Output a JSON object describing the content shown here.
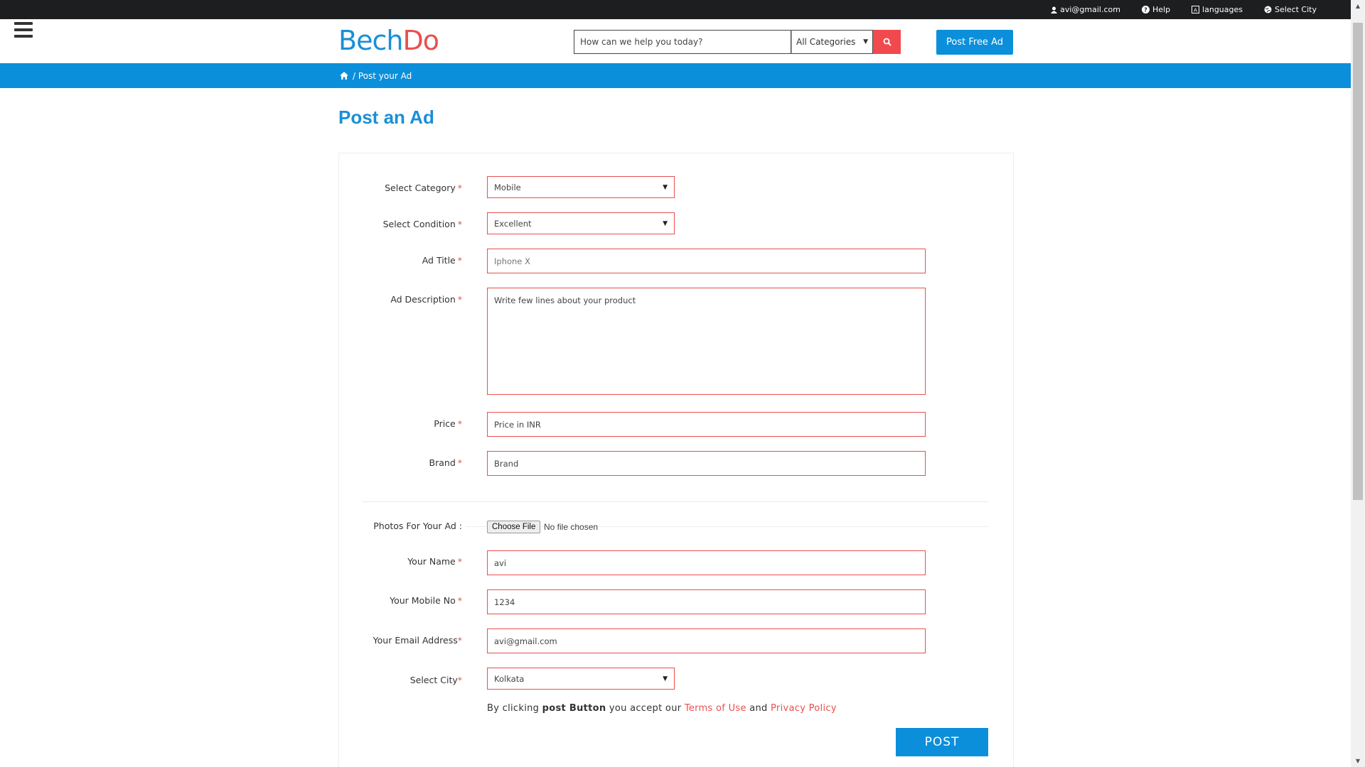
{
  "topbar": {
    "email": "avi@gmail.com",
    "help": "Help",
    "languages": "languages",
    "city": "Select City"
  },
  "header": {
    "logo_part1": "Bech",
    "logo_part2": "Do",
    "search_placeholder": "How can we help you today?",
    "category_select": "All Categories",
    "post_free_ad": "Post Free Ad"
  },
  "breadcrumb": {
    "home_icon": "home-icon",
    "current": "/ Post your Ad"
  },
  "page_title": "Post an Ad",
  "form": {
    "category": {
      "label": "Select Category",
      "value": "Mobile"
    },
    "condition": {
      "label": "Select Condition",
      "value": "Excellent"
    },
    "ad_title": {
      "label": "Ad Title",
      "placeholder": "Iphone X"
    },
    "ad_description": {
      "label": "Ad Description",
      "placeholder": "Write few lines about your product"
    },
    "price": {
      "label": "Price",
      "placeholder": "Price in INR"
    },
    "brand": {
      "label": "Brand",
      "placeholder": "Brand"
    },
    "photos": {
      "label": "Photos For Your Ad :",
      "button": "Choose File",
      "status": "No file chosen"
    },
    "name": {
      "label": "Your Name",
      "value": "avi"
    },
    "mobile": {
      "label": "Your Mobile No",
      "value": "1234"
    },
    "email": {
      "label": "Your Email Address",
      "value": "avi@gmail.com"
    },
    "city": {
      "label": "Select City",
      "value": "Kolkata"
    },
    "required_marker": "*",
    "terms": {
      "prefix": "By clicking",
      "bold": "post Button",
      "middle": "you accept our",
      "link1": "Terms of Use",
      "and": "and",
      "link2": "Privacy Policy"
    },
    "post_button": "POST"
  },
  "colors": {
    "brand_blue": "#0b8fdb",
    "brand_red": "#e8504f",
    "topbar": "#1c1e20"
  }
}
